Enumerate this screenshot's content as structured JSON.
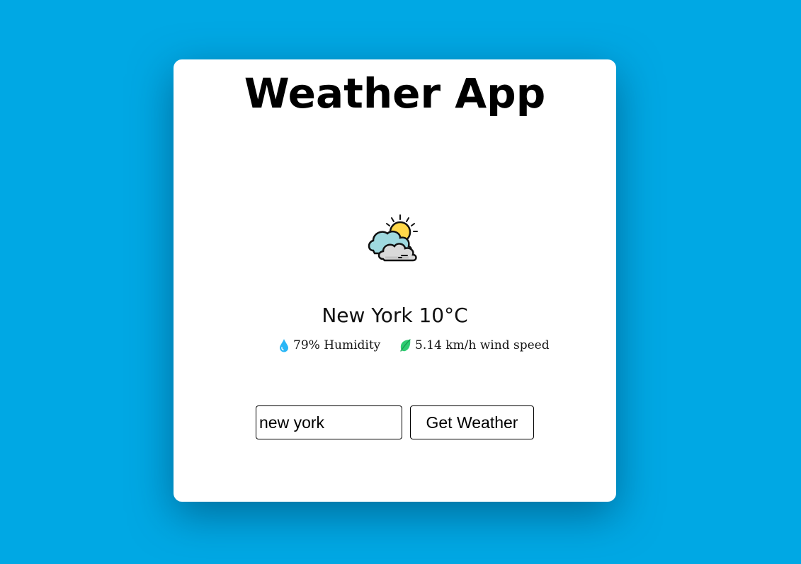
{
  "app": {
    "title": "Weather App"
  },
  "weather": {
    "icon": "partly-cloudy-icon",
    "location_temp": "New York 10°C",
    "humidity_icon": "water-drop-icon",
    "humidity_text": "79% Humidity",
    "wind_icon": "leaf-icon",
    "wind_text": "5.14 km/h wind speed"
  },
  "search": {
    "value": "new york",
    "button_label": "Get Weather"
  },
  "colors": {
    "background": "#00a8e4",
    "card": "#ffffff",
    "drop": "#29b6f6",
    "leaf": "#2ecc71"
  }
}
